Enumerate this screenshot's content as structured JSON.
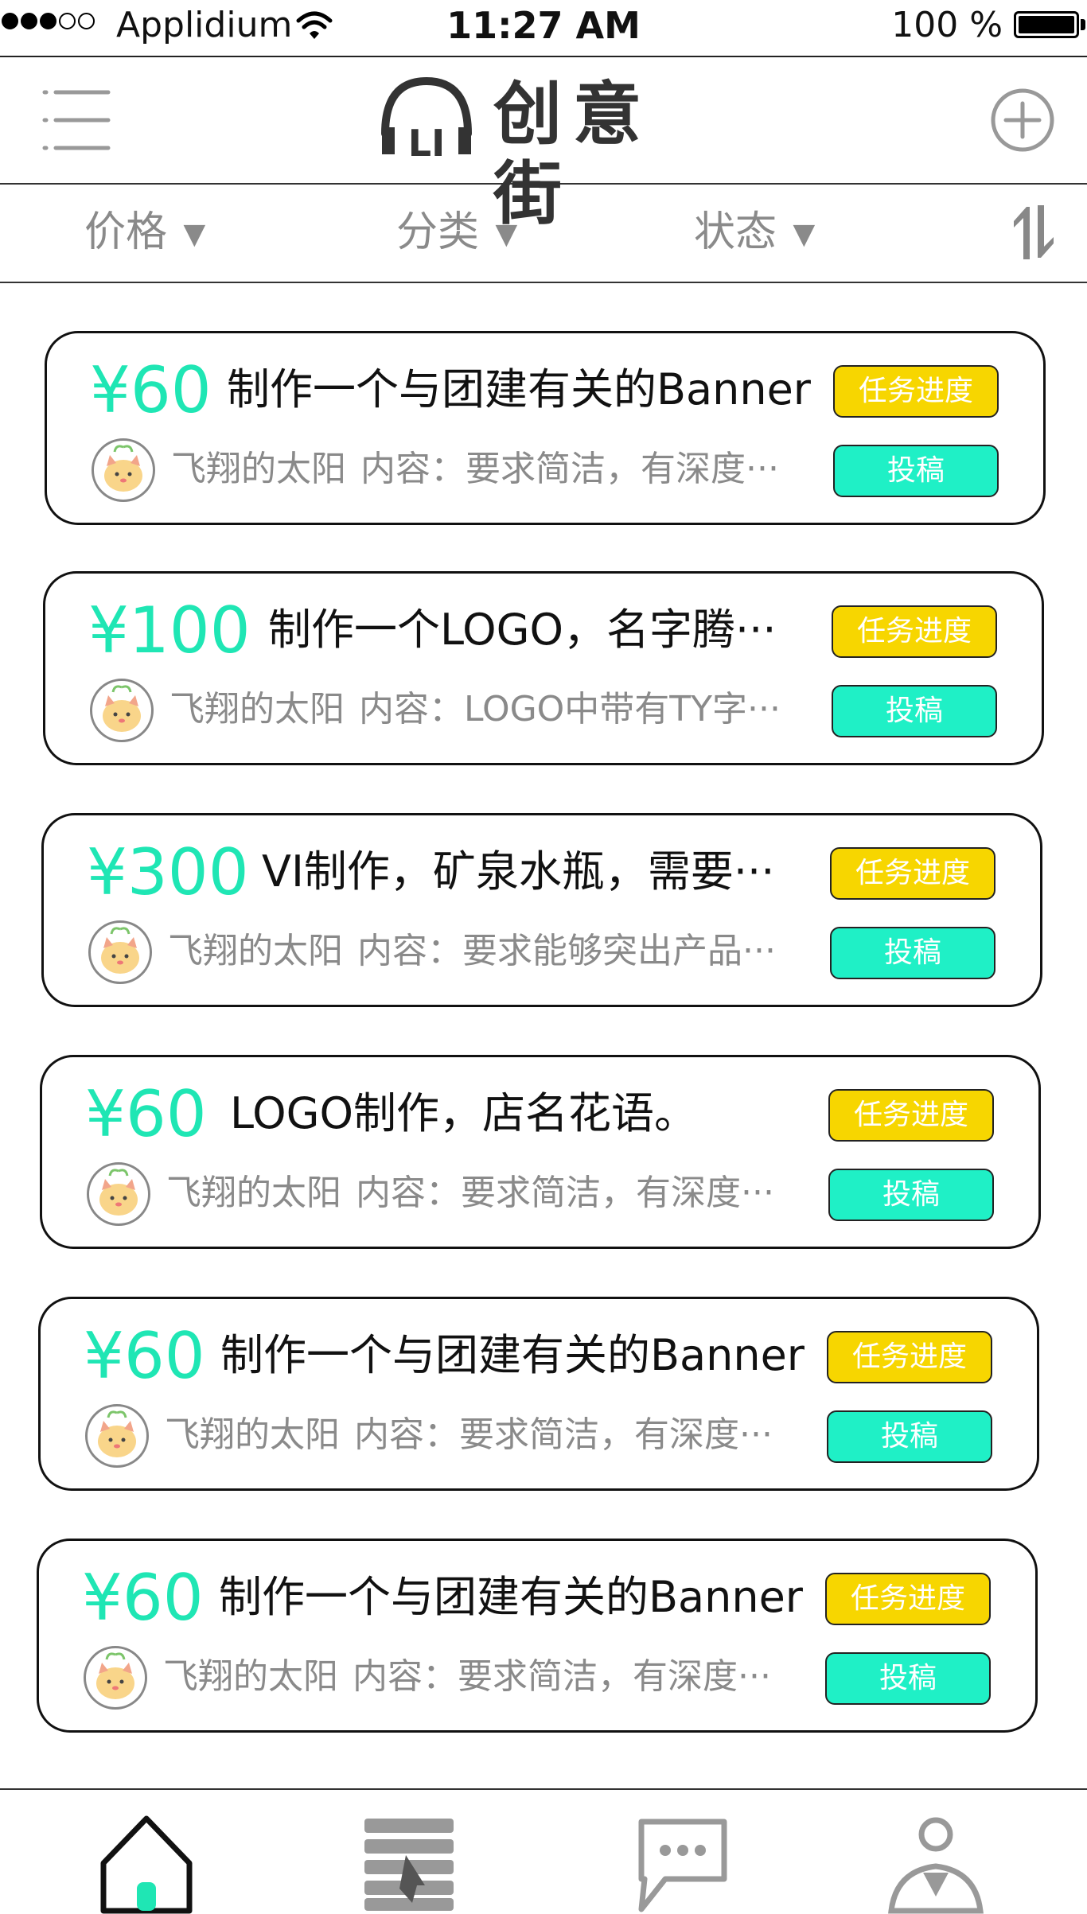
{
  "status_bar": {
    "carrier": "Applidium",
    "time": "11:27 AM",
    "battery": "100 %",
    "signal_bars_filled": 3,
    "signal_bars_total": 5
  },
  "header": {
    "title": "创意街",
    "logo_mark": "LI",
    "menu_icon": "hamburger-menu-icon",
    "add_icon": "plus-circle-icon"
  },
  "filters": {
    "price": "价格",
    "category": "分类",
    "status": "状态",
    "arrow": "▼",
    "sort_icon": "sort-icon"
  },
  "tasks": [
    {
      "price": "¥60",
      "title": "制作一个与团建有关的Banner",
      "author": "飞翔的太阳",
      "content": "内容：要求简洁，有深度···",
      "progress_label": "任务进度",
      "submit_label": "投稿"
    },
    {
      "price": "¥100",
      "title": "制作一个LOGO，名字腾···",
      "author": "飞翔的太阳",
      "content": "内容：LOGO中带有TY字···",
      "progress_label": "任务进度",
      "submit_label": "投稿"
    },
    {
      "price": "¥300",
      "title": "VI制作，矿泉水瓶，需要···",
      "author": "飞翔的太阳",
      "content": "内容：要求能够突出产品···",
      "progress_label": "任务进度",
      "submit_label": "投稿"
    },
    {
      "price": "¥60",
      "title": "LOGO制作，店名花语。",
      "author": "飞翔的太阳",
      "content": "内容：要求简洁，有深度···",
      "progress_label": "任务进度",
      "submit_label": "投稿"
    },
    {
      "price": "¥60",
      "title": "制作一个与团建有关的Banner",
      "author": "飞翔的太阳",
      "content": "内容：要求简洁，有深度···",
      "progress_label": "任务进度",
      "submit_label": "投稿"
    },
    {
      "price": "¥60",
      "title": "制作一个与团建有关的Banner",
      "author": "飞翔的太阳",
      "content": "内容：要求简洁，有深度···",
      "progress_label": "任务进度",
      "submit_label": "投稿"
    }
  ],
  "tabs": [
    {
      "icon": "home-icon",
      "active": true
    },
    {
      "icon": "books-icon",
      "active": false
    },
    {
      "icon": "chat-icon",
      "active": false
    },
    {
      "icon": "profile-icon",
      "active": false
    }
  ],
  "colors": {
    "accent": "#1fe6b4",
    "progress_button": "#f7d600",
    "submit_button": "#1ff0c6",
    "muted_text": "#8a8a8a"
  }
}
